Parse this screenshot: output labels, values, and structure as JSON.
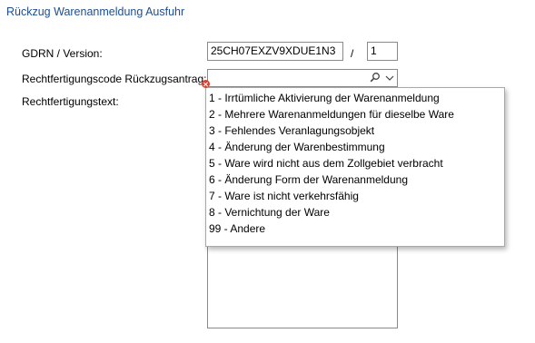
{
  "title": "Rückzug Warenanmeldung Ausfuhr",
  "gdrn": {
    "label": "GDRN / Version:",
    "value": "25CH07EXZV9XDUE1N3",
    "separator": "/",
    "version": "1"
  },
  "justification_code": {
    "label": "Rechtfertigungscode Rückzugsantrag:",
    "value": "",
    "icons": [
      "search-icon",
      "chevron-down-icon"
    ]
  },
  "justification_text": {
    "label": "Rechtfertigungstext:",
    "value": ""
  },
  "dropdown": {
    "options": [
      "1 - Irrtümliche Aktivierung der Warenanmeldung",
      "2 - Mehrere Warenanmeldungen für dieselbe Ware",
      "3 - Fehlendes Veranlagungsobjekt",
      "4 - Änderung der Warenbestimmung",
      "5 - Ware wird nicht aus dem Zollgebiet verbracht",
      "6 - Änderung Form der Warenanmeldung",
      "7 - Ware ist nicht verkehrsfähig",
      "8 - Vernichtung der Ware",
      "99 - Andere"
    ]
  },
  "colors": {
    "title": "#1f4e8c",
    "error": "#d9412f",
    "border": "#8a8a8a"
  }
}
